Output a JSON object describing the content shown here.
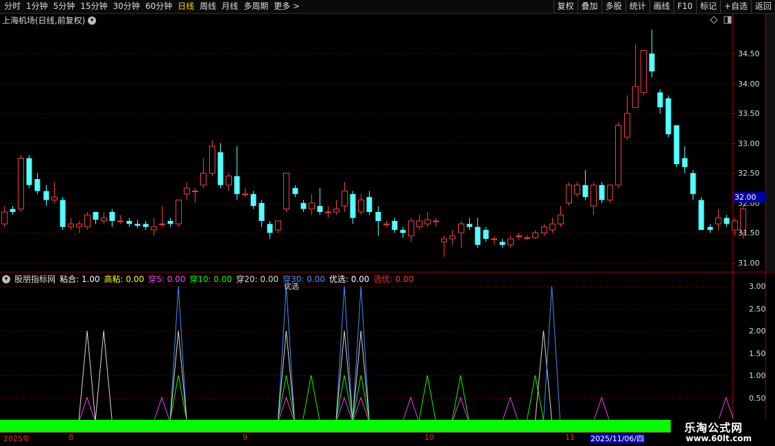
{
  "toolbar": {
    "periods": [
      "分时",
      "1分钟",
      "5分钟",
      "15分钟",
      "30分钟",
      "60分钟",
      "日线",
      "周线",
      "月线",
      "多周期",
      "更多 >"
    ],
    "active_period": "日线",
    "right_buttons": [
      "复权",
      "叠加",
      "多股",
      "统计",
      "画线",
      "F10",
      "标记",
      "+自选",
      "返回"
    ]
  },
  "main": {
    "title": "上海机场(日线,前复权)",
    "price_ticks": [
      "34.50",
      "34.00",
      "33.50",
      "33.00",
      "32.50",
      "32.00",
      "31.50",
      "31.00"
    ],
    "current_price": "32.00"
  },
  "indicator": {
    "name": "股朋指标网",
    "items": [
      {
        "label": "粘合: 1.00",
        "color": "#ffffff"
      },
      {
        "label": "高粘: 0.00",
        "color": "#ffff00"
      },
      {
        "label": "穿5: 0.00",
        "color": "#ff40ff"
      },
      {
        "label": "穿10: 0.00",
        "color": "#00ff00"
      },
      {
        "label": "穿20: 0.00",
        "color": "#dddddd"
      },
      {
        "label": "穿30: 0.00",
        "color": "#4a90ff"
      },
      {
        "label": "优选: 0.00",
        "color": "#ffffff"
      },
      {
        "label": "选优: 0.00",
        "color": "#ff3030"
      }
    ],
    "ticks": [
      "3.00",
      "2.50",
      "2.00",
      "1.50",
      "1.00",
      "0.50"
    ],
    "annotation": "优选"
  },
  "dates": [
    "2025年",
    "8",
    "9",
    "10",
    "11"
  ],
  "selected_date": "2025/11/06/四",
  "watermark": {
    "title": "乐淘公式网",
    "url": "www.60lt.com"
  },
  "colors": {
    "up": "#ff3c3c",
    "down": "#54ffff",
    "grid": "#a00000",
    "bg": "#000000"
  },
  "chart_data": [
    {
      "type": "candlestick",
      "title": "上海机场(日线,前复权)",
      "ylim": [
        31.0,
        34.5
      ],
      "candles": [
        {
          "o": 31.65,
          "c": 31.85,
          "h": 31.95,
          "l": 31.6
        },
        {
          "o": 31.9,
          "c": 31.85,
          "h": 31.95,
          "l": 31.8
        },
        {
          "o": 31.9,
          "c": 32.75,
          "h": 32.8,
          "l": 31.85
        },
        {
          "o": 32.75,
          "c": 32.3,
          "h": 32.8,
          "l": 32.25
        },
        {
          "o": 32.4,
          "c": 32.2,
          "h": 32.5,
          "l": 32.15
        },
        {
          "o": 32.2,
          "c": 32.05,
          "h": 32.3,
          "l": 31.95
        },
        {
          "o": 32.05,
          "c": 32.1,
          "h": 32.35,
          "l": 32.0
        },
        {
          "o": 32.05,
          "c": 31.6,
          "h": 32.1,
          "l": 31.55
        },
        {
          "o": 31.6,
          "c": 31.65,
          "h": 31.75,
          "l": 31.55
        },
        {
          "o": 31.6,
          "c": 31.65,
          "h": 31.7,
          "l": 31.5
        },
        {
          "o": 31.6,
          "c": 31.8,
          "h": 31.85,
          "l": 31.55
        },
        {
          "o": 31.85,
          "c": 31.72,
          "h": 31.85,
          "l": 31.65
        },
        {
          "o": 31.7,
          "c": 31.75,
          "h": 31.85,
          "l": 31.65
        },
        {
          "o": 31.85,
          "c": 31.7,
          "h": 31.9,
          "l": 31.6
        },
        {
          "o": 31.7,
          "c": 31.7,
          "h": 31.8,
          "l": 31.65
        },
        {
          "o": 31.7,
          "c": 31.65,
          "h": 31.75,
          "l": 31.6
        },
        {
          "o": 31.65,
          "c": 31.62,
          "h": 31.72,
          "l": 31.58
        },
        {
          "o": 31.65,
          "c": 31.6,
          "h": 31.7,
          "l": 31.55
        },
        {
          "o": 31.55,
          "c": 31.6,
          "h": 31.75,
          "l": 31.45
        },
        {
          "o": 31.65,
          "c": 31.65,
          "h": 31.95,
          "l": 31.6
        },
        {
          "o": 31.7,
          "c": 31.65,
          "h": 31.75,
          "l": 31.6
        },
        {
          "o": 31.65,
          "c": 32.05,
          "h": 32.05,
          "l": 31.6
        },
        {
          "o": 32.15,
          "c": 32.25,
          "h": 32.35,
          "l": 32.05
        },
        {
          "o": 32.2,
          "c": 32.2,
          "h": 32.25,
          "l": 32.0
        },
        {
          "o": 32.3,
          "c": 32.5,
          "h": 32.75,
          "l": 32.25
        },
        {
          "o": 32.5,
          "c": 32.95,
          "h": 33.05,
          "l": 32.45
        },
        {
          "o": 32.85,
          "c": 32.3,
          "h": 33.0,
          "l": 32.25
        },
        {
          "o": 32.3,
          "c": 32.45,
          "h": 32.5,
          "l": 32.2
        },
        {
          "o": 32.45,
          "c": 32.15,
          "h": 32.95,
          "l": 32.05
        },
        {
          "o": 32.15,
          "c": 32.15,
          "h": 32.25,
          "l": 32.1
        },
        {
          "o": 32.15,
          "c": 31.95,
          "h": 32.2,
          "l": 31.9
        },
        {
          "o": 32.0,
          "c": 31.7,
          "h": 32.05,
          "l": 31.6
        },
        {
          "o": 31.65,
          "c": 31.5,
          "h": 31.7,
          "l": 31.4
        },
        {
          "o": 31.55,
          "c": 31.7,
          "h": 31.7,
          "l": 31.5
        },
        {
          "o": 31.9,
          "c": 32.5,
          "h": 32.5,
          "l": 31.85
        },
        {
          "o": 32.25,
          "c": 32.15,
          "h": 32.3,
          "l": 32.1
        },
        {
          "o": 32.0,
          "c": 31.9,
          "h": 32.05,
          "l": 31.85
        },
        {
          "o": 31.9,
          "c": 32.0,
          "h": 32.15,
          "l": 31.8
        },
        {
          "o": 31.95,
          "c": 31.85,
          "h": 32.25,
          "l": 31.8
        },
        {
          "o": 31.85,
          "c": 31.85,
          "h": 31.95,
          "l": 31.75
        },
        {
          "o": 31.85,
          "c": 31.9,
          "h": 32.05,
          "l": 31.8
        },
        {
          "o": 31.95,
          "c": 32.2,
          "h": 32.35,
          "l": 31.85
        },
        {
          "o": 32.15,
          "c": 31.75,
          "h": 32.2,
          "l": 31.65
        },
        {
          "o": 31.85,
          "c": 32.05,
          "h": 32.15,
          "l": 31.8
        },
        {
          "o": 32.1,
          "c": 31.85,
          "h": 32.2,
          "l": 31.8
        },
        {
          "o": 31.85,
          "c": 31.7,
          "h": 31.95,
          "l": 31.45
        },
        {
          "o": 31.65,
          "c": 31.65,
          "h": 31.7,
          "l": 31.6
        },
        {
          "o": 31.7,
          "c": 31.55,
          "h": 31.75,
          "l": 31.5
        },
        {
          "o": 31.55,
          "c": 31.5,
          "h": 31.6,
          "l": 31.42
        },
        {
          "o": 31.45,
          "c": 31.7,
          "h": 31.75,
          "l": 31.35
        },
        {
          "o": 31.6,
          "c": 31.7,
          "h": 31.8,
          "l": 31.55
        },
        {
          "o": 31.65,
          "c": 31.72,
          "h": 31.85,
          "l": 31.6
        },
        {
          "o": 31.7,
          "c": 31.7,
          "h": 31.75,
          "l": 31.6
        },
        {
          "o": 31.35,
          "c": 31.4,
          "h": 31.45,
          "l": 31.1
        },
        {
          "o": 31.4,
          "c": 31.45,
          "h": 31.55,
          "l": 31.3
        },
        {
          "o": 31.5,
          "c": 31.65,
          "h": 31.7,
          "l": 31.25
        },
        {
          "o": 31.65,
          "c": 31.6,
          "h": 31.75,
          "l": 31.55
        },
        {
          "o": 31.6,
          "c": 31.3,
          "h": 31.75,
          "l": 31.25
        },
        {
          "o": 31.55,
          "c": 31.4,
          "h": 31.6,
          "l": 31.35
        },
        {
          "o": 31.4,
          "c": 31.4,
          "h": 31.45,
          "l": 31.3
        },
        {
          "o": 31.35,
          "c": 31.3,
          "h": 31.4,
          "l": 31.25
        },
        {
          "o": 31.3,
          "c": 31.4,
          "h": 31.45,
          "l": 31.25
        },
        {
          "o": 31.45,
          "c": 31.45,
          "h": 31.5,
          "l": 31.38
        },
        {
          "o": 31.42,
          "c": 31.42,
          "h": 31.46,
          "l": 31.38
        },
        {
          "o": 31.42,
          "c": 31.5,
          "h": 31.55,
          "l": 31.4
        },
        {
          "o": 31.5,
          "c": 31.6,
          "h": 31.65,
          "l": 31.45
        },
        {
          "o": 31.55,
          "c": 31.65,
          "h": 31.75,
          "l": 31.5
        },
        {
          "o": 31.65,
          "c": 31.8,
          "h": 31.95,
          "l": 31.6
        },
        {
          "o": 32.0,
          "c": 32.3,
          "h": 32.35,
          "l": 31.95
        },
        {
          "o": 32.15,
          "c": 32.3,
          "h": 32.35,
          "l": 32.1
        },
        {
          "o": 32.3,
          "c": 32.1,
          "h": 32.55,
          "l": 32.05
        },
        {
          "o": 31.95,
          "c": 32.3,
          "h": 32.35,
          "l": 31.8
        },
        {
          "o": 32.3,
          "c": 32.05,
          "h": 32.35,
          "l": 32.0
        },
        {
          "o": 32.05,
          "c": 32.3,
          "h": 32.3,
          "l": 32.0
        },
        {
          "o": 32.3,
          "c": 33.3,
          "h": 33.35,
          "l": 32.25
        },
        {
          "o": 33.1,
          "c": 33.5,
          "h": 33.8,
          "l": 33.05
        },
        {
          "o": 33.6,
          "c": 33.95,
          "h": 34.65,
          "l": 33.6
        },
        {
          "o": 33.85,
          "c": 34.55,
          "h": 34.55,
          "l": 33.8
        },
        {
          "o": 34.5,
          "c": 34.2,
          "h": 34.9,
          "l": 34.1
        },
        {
          "o": 33.85,
          "c": 33.6,
          "h": 33.9,
          "l": 33.5
        },
        {
          "o": 33.75,
          "c": 33.15,
          "h": 33.8,
          "l": 33.1
        },
        {
          "o": 33.3,
          "c": 32.65,
          "h": 33.3,
          "l": 32.6
        },
        {
          "o": 32.75,
          "c": 32.6,
          "h": 32.95,
          "l": 32.5
        },
        {
          "o": 32.5,
          "c": 32.15,
          "h": 32.55,
          "l": 32.05
        },
        {
          "o": 32.05,
          "c": 31.55,
          "h": 32.1,
          "l": 31.55
        },
        {
          "o": 31.6,
          "c": 31.55,
          "h": 31.65,
          "l": 31.5
        },
        {
          "o": 31.65,
          "c": 31.75,
          "h": 31.9,
          "l": 31.55
        },
        {
          "o": 31.75,
          "c": 31.65,
          "h": 31.8,
          "l": 31.6
        },
        {
          "o": 31.55,
          "c": 31.7,
          "h": 31.75,
          "l": 31.45
        },
        {
          "o": 31.5,
          "c": 31.9,
          "h": 31.95,
          "l": 31.4
        }
      ]
    },
    {
      "type": "line",
      "title": "股朋指标网",
      "ylim": [
        0,
        3.0
      ],
      "spikes": [
        {
          "series": "穿20",
          "x": 10,
          "value": 2.0
        },
        {
          "series": "穿5",
          "x": 10,
          "value": 0.5
        },
        {
          "series": "穿20",
          "x": 12,
          "value": 2.0
        },
        {
          "series": "穿5",
          "x": 19,
          "value": 0.5
        },
        {
          "series": "穿30",
          "x": 21,
          "value": 3.0
        },
        {
          "series": "穿20",
          "x": 21,
          "value": 2.0
        },
        {
          "series": "穿10",
          "x": 21,
          "value": 1.0
        },
        {
          "series": "穿30",
          "x": 34,
          "value": 3.0
        },
        {
          "series": "穿20",
          "x": 34,
          "value": 2.0
        },
        {
          "series": "穿10",
          "x": 34,
          "value": 1.0
        },
        {
          "series": "穿5",
          "x": 34,
          "value": 0.5
        },
        {
          "series": "穿10",
          "x": 37,
          "value": 1.0
        },
        {
          "series": "穿30",
          "x": 41,
          "value": 3.0
        },
        {
          "series": "穿20",
          "x": 41,
          "value": 2.0
        },
        {
          "series": "穿10",
          "x": 41,
          "value": 1.0
        },
        {
          "series": "穿5",
          "x": 41,
          "value": 0.5
        },
        {
          "series": "穿30",
          "x": 43,
          "value": 3.0
        },
        {
          "series": "穿20",
          "x": 43,
          "value": 2.0
        },
        {
          "series": "穿10",
          "x": 43,
          "value": 1.0
        },
        {
          "series": "穿5",
          "x": 43,
          "value": 0.5
        },
        {
          "series": "穿5",
          "x": 49,
          "value": 0.5
        },
        {
          "series": "穿10",
          "x": 51,
          "value": 1.0
        },
        {
          "series": "穿10",
          "x": 55,
          "value": 1.0
        },
        {
          "series": "穿5",
          "x": 55,
          "value": 0.5
        },
        {
          "series": "穿5",
          "x": 61,
          "value": 0.5
        },
        {
          "series": "穿10",
          "x": 64,
          "value": 1.0
        },
        {
          "series": "穿20",
          "x": 65,
          "value": 2.0
        },
        {
          "series": "穿30",
          "x": 66,
          "value": 3.0
        },
        {
          "series": "穿5",
          "x": 72,
          "value": 0.5
        },
        {
          "series": "穿5",
          "x": 87,
          "value": 0.5
        }
      ]
    }
  ]
}
